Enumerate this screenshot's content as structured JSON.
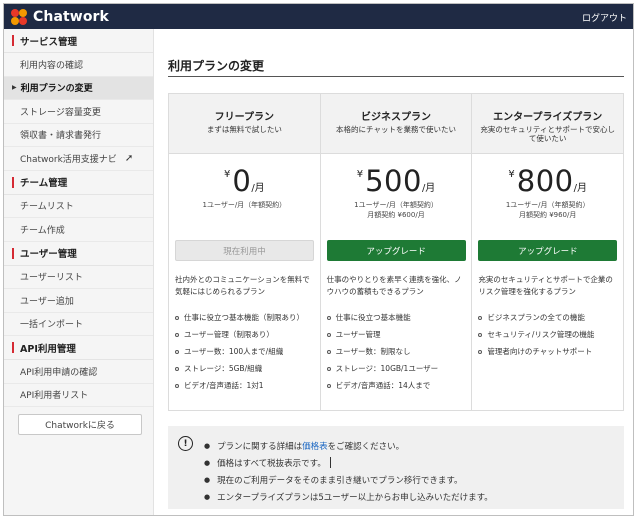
{
  "header": {
    "logo_text": "Chatwork",
    "logout_label": "ログアウト",
    "logo_colors": [
      "#e83828",
      "#f39800",
      "#e83828",
      "#f39800"
    ]
  },
  "sidebar": {
    "sections": [
      {
        "title": "サービス管理",
        "items": [
          {
            "label": "利用内容の確認"
          },
          {
            "label": "利用プランの変更",
            "active": true
          },
          {
            "label": "ストレージ容量変更"
          },
          {
            "label": "領収書・請求書発行"
          },
          {
            "label": "Chatwork活用支援ナビ",
            "external": true
          }
        ]
      },
      {
        "title": "チーム管理",
        "items": [
          {
            "label": "チームリスト"
          },
          {
            "label": "チーム作成"
          }
        ]
      },
      {
        "title": "ユーザー管理",
        "items": [
          {
            "label": "ユーザーリスト"
          },
          {
            "label": "ユーザー追加"
          },
          {
            "label": "一括インポート"
          }
        ]
      },
      {
        "title": "API利用管理",
        "items": [
          {
            "label": "API利用申請の確認"
          },
          {
            "label": "API利用者リスト"
          }
        ]
      }
    ],
    "back_button": "Chatworkに戻る"
  },
  "main": {
    "title": "利用プランの変更",
    "plans": [
      {
        "name": "フリープラン",
        "subtitle": "まずは無料で試したい",
        "currency": "¥",
        "price": "0",
        "unit": "/月",
        "note_line1": "1ユーザー/月（年額契約）",
        "note_line2": "",
        "button": "現在利用中",
        "button_state": "current",
        "description": "社内外とのコミュニケーションを無料で気軽にはじめられるプラン",
        "features": [
          "仕事に役立つ基本機能（制限あり）",
          "ユーザー管理（制限あり）",
          "ユーザー数：100人まで/組織",
          "ストレージ：5GB/組織",
          "ビデオ/音声通話：1対1"
        ]
      },
      {
        "name": "ビジネスプラン",
        "subtitle": "本格的にチャットを業務で使いたい",
        "currency": "¥",
        "price": "500",
        "unit": "/月",
        "note_line1": "1ユーザー/月（年額契約）",
        "note_line2": "月額契約 ¥600/月",
        "button": "アップグレード",
        "button_state": "upgrade",
        "description": "仕事のやりとりを素早く連携を強化、ノウハウの蓄積もできるプラン",
        "features": [
          "仕事に役立つ基本機能",
          "ユーザー管理",
          "ユーザー数：制限なし",
          "ストレージ：10GB/1ユーザー",
          "ビデオ/音声通話：14人まで"
        ]
      },
      {
        "name": "エンタープライズプラン",
        "subtitle": "充実のセキュリティとサポートで安心して使いたい",
        "currency": "¥",
        "price": "800",
        "unit": "/月",
        "note_line1": "1ユーザー/月（年額契約）",
        "note_line2": "月額契約 ¥960/月",
        "button": "アップグレード",
        "button_state": "upgrade",
        "description": "充実のセキュリティとサポートで企業のリスク管理を強化するプラン",
        "features": [
          "ビジネスプランの全ての機能",
          "セキュリティ/リスク管理の機能",
          "管理者向けのチャットサポート"
        ]
      }
    ],
    "notes": {
      "line1_prefix": "プランに関する詳細は",
      "line1_link": "価格表",
      "line1_suffix": "をご確認ください。",
      "line2": "価格はすべて税抜表示です。",
      "line3": "現在のご利用データをそのまま引き継いでプラン移行できます。",
      "line4": "エンタープライズプランは5ユーザー以上からお申し込みいただけます。"
    }
  }
}
